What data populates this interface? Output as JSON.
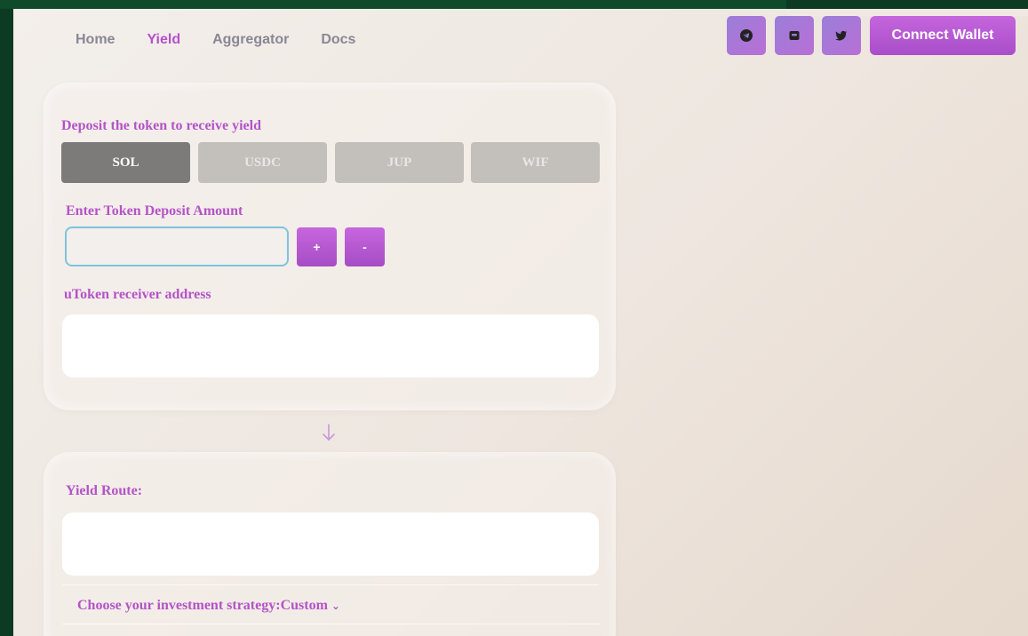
{
  "nav": {
    "links": [
      {
        "label": "Home",
        "active": false
      },
      {
        "label": "Yield",
        "active": true
      },
      {
        "label": "Aggregator",
        "active": false
      },
      {
        "label": "Docs",
        "active": false
      }
    ],
    "social_icons": [
      "telegram-icon",
      "discord-icon",
      "twitter-icon"
    ],
    "connect_label": "Connect Wallet"
  },
  "deposit": {
    "heading": "Deposit the token to receive yield",
    "tokens": [
      "SOL",
      "USDC",
      "JUP",
      "WIF"
    ],
    "selected_token": "SOL",
    "amount_label": "Enter Token Deposit Amount",
    "amount_value": "",
    "plus_label": "+",
    "minus_label": "-",
    "receiver_label": "uToken receiver address",
    "receiver_value": ""
  },
  "route": {
    "arrow_icon": "arrow-down-icon",
    "label": "Yield Route:",
    "value": "",
    "strategy_label": "Choose your investment strategy:Custom",
    "strategy_chevron": "⌄"
  },
  "colors": {
    "accent": "#b453c8",
    "button_gradient_start": "#c766de",
    "button_gradient_end": "#a54dc5",
    "token_active": "#7d7b7a",
    "token_inactive": "#c3bfbb",
    "input_border": "#7ec4dc"
  }
}
